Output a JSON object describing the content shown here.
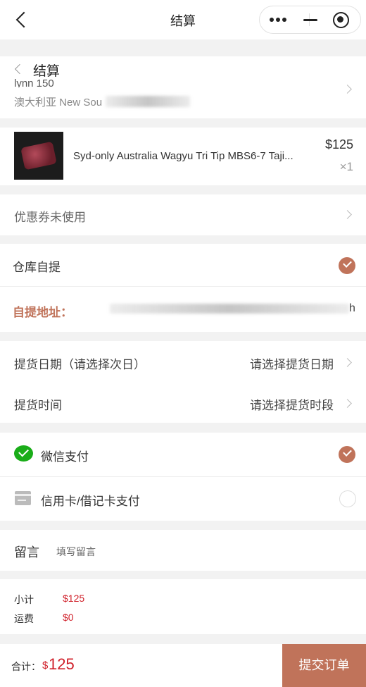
{
  "nav": {
    "title": "结算",
    "capsule": {
      "more_icon": "dots-icon",
      "min_icon": "minimize-icon",
      "close_icon": "target-icon"
    }
  },
  "subheader": {
    "title": "结算"
  },
  "address": {
    "name_partial": "lynn 150",
    "country": "澳大利亚 New Sou"
  },
  "product": {
    "name": "Syd-only Australia Wagyu Tri Tip MBS6-7 Taji...",
    "price": "$125",
    "qty": "×1"
  },
  "coupon": {
    "label": "优惠券",
    "status": "未使用"
  },
  "pickup": {
    "label": "仓库自提",
    "address_label": "自提地址：",
    "address_tail": "h"
  },
  "date": {
    "label": "提货日期（请选择次日）",
    "value": "请选择提货日期"
  },
  "time": {
    "label": "提货时间",
    "value": "请选择提货时段"
  },
  "payment": {
    "wechat": "微信支付",
    "card": "信用卡/借记卡支付"
  },
  "note": {
    "label": "留言",
    "placeholder": "填写留言"
  },
  "summary": {
    "subtotal_label": "小计",
    "subtotal": "$125",
    "shipping_label": "运费",
    "shipping": "$0"
  },
  "footer": {
    "total_label": "合计：",
    "currency": "$",
    "total": "125",
    "submit": "提交订单"
  },
  "colors": {
    "accent": "#c0735a",
    "price_red": "#d0202a",
    "wechat_green": "#1aad19"
  }
}
